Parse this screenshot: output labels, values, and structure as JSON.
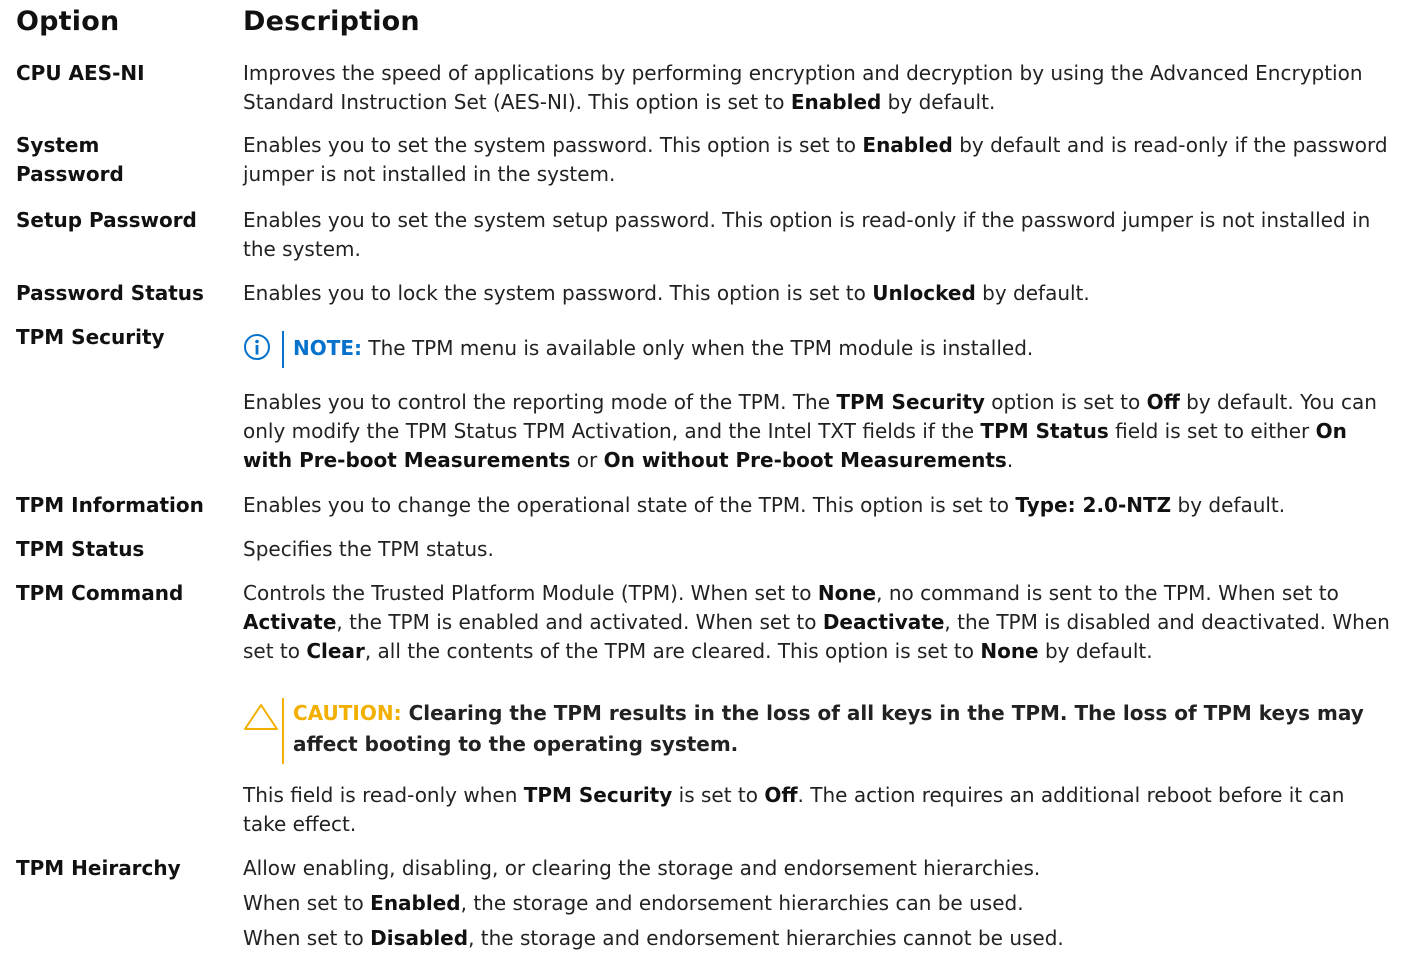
{
  "header": {
    "option": "Option",
    "description": "Description"
  },
  "rows": {
    "cpu_aes_ni": {
      "option": "CPU AES-NI",
      "desc_a": "Improves the speed of applications by performing encryption and decryption by using the Advanced Encryption Standard Instruction Set (AES-NI). This option is set to ",
      "desc_b": "Enabled",
      "desc_c": " by default."
    },
    "system_password": {
      "option": "System Password",
      "desc_a": "Enables you to set the system password. This option is set to ",
      "desc_b": "Enabled",
      "desc_c": " by default and is read-only if the password jumper is not installed in the system."
    },
    "setup_password": {
      "option": "Setup Password",
      "desc": "Enables you to set the system setup password. This option is read-only if the password jumper is not installed in the system."
    },
    "password_status": {
      "option": "Password Status",
      "desc_a": "Enables you to lock the system password. This option is set to ",
      "desc_b": "Unlocked",
      "desc_c": " by default."
    },
    "tpm_security": {
      "option": "TPM Security",
      "note_label": "NOTE:",
      "note_text": " The TPM menu is available only when the TPM module is installed.",
      "p1": "Enables you to control the reporting mode of the TPM. The ",
      "p2": "TPM Security",
      "p3": " option is set to ",
      "p4": "Off",
      "p5": " by default. You can only modify the TPM Status TPM Activation, and the Intel TXT fields if the ",
      "p6": "TPM Status",
      "p7": " field is set to either ",
      "p8": "On with Pre-boot Measurements",
      "p9": " or ",
      "p10": "On without Pre-boot Measurements",
      "p11": "."
    },
    "tpm_information": {
      "option": "TPM Information",
      "desc_a": "Enables you to change the operational state of the TPM. This option is set to ",
      "desc_b": "Type: 2.0-NTZ",
      "desc_c": " by default."
    },
    "tpm_status": {
      "option": "TPM Status",
      "desc": "Specifies the TPM status."
    },
    "tpm_command": {
      "option": "TPM Command",
      "p1": "Controls the Trusted Platform Module (TPM). When set to ",
      "p2": "None",
      "p3": ", no command is sent to the TPM. When set to ",
      "p4": "Activate",
      "p5": ", the TPM is enabled and activated. When set to ",
      "p6": "Deactivate",
      "p7": ", the TPM is disabled and deactivated. When set to ",
      "p8": "Clear",
      "p9": ", all the contents of the TPM are cleared. This option is set to ",
      "p10": "None",
      "p11": " by default.",
      "caution_label": "CAUTION:",
      "caution_text": " Clearing the TPM results in the loss of all keys in the TPM. The loss of TPM keys may affect booting to the operating system.",
      "q1": "This field is read-only when ",
      "q2": "TPM Security",
      "q3": " is set to ",
      "q4": "Off",
      "q5": ". The action requires an additional reboot before it can take effect."
    },
    "tpm_heirarchy": {
      "option": "TPM Heirarchy",
      "l1": "Allow enabling, disabling, or clearing the storage and endorsement hierarchies.",
      "l2a": "When set to ",
      "l2b": "Enabled",
      "l2c": ", the storage and endorsement hierarchies can be used.",
      "l3a": "When set to ",
      "l3b": "Disabled",
      "l3c": ", the storage and endorsement hierarchies cannot be used."
    }
  },
  "icons": {
    "note": "info-icon",
    "caution": "warning-triangle-icon"
  },
  "colors": {
    "note_accent": "#0672cb",
    "caution_accent": "#f2af00"
  }
}
